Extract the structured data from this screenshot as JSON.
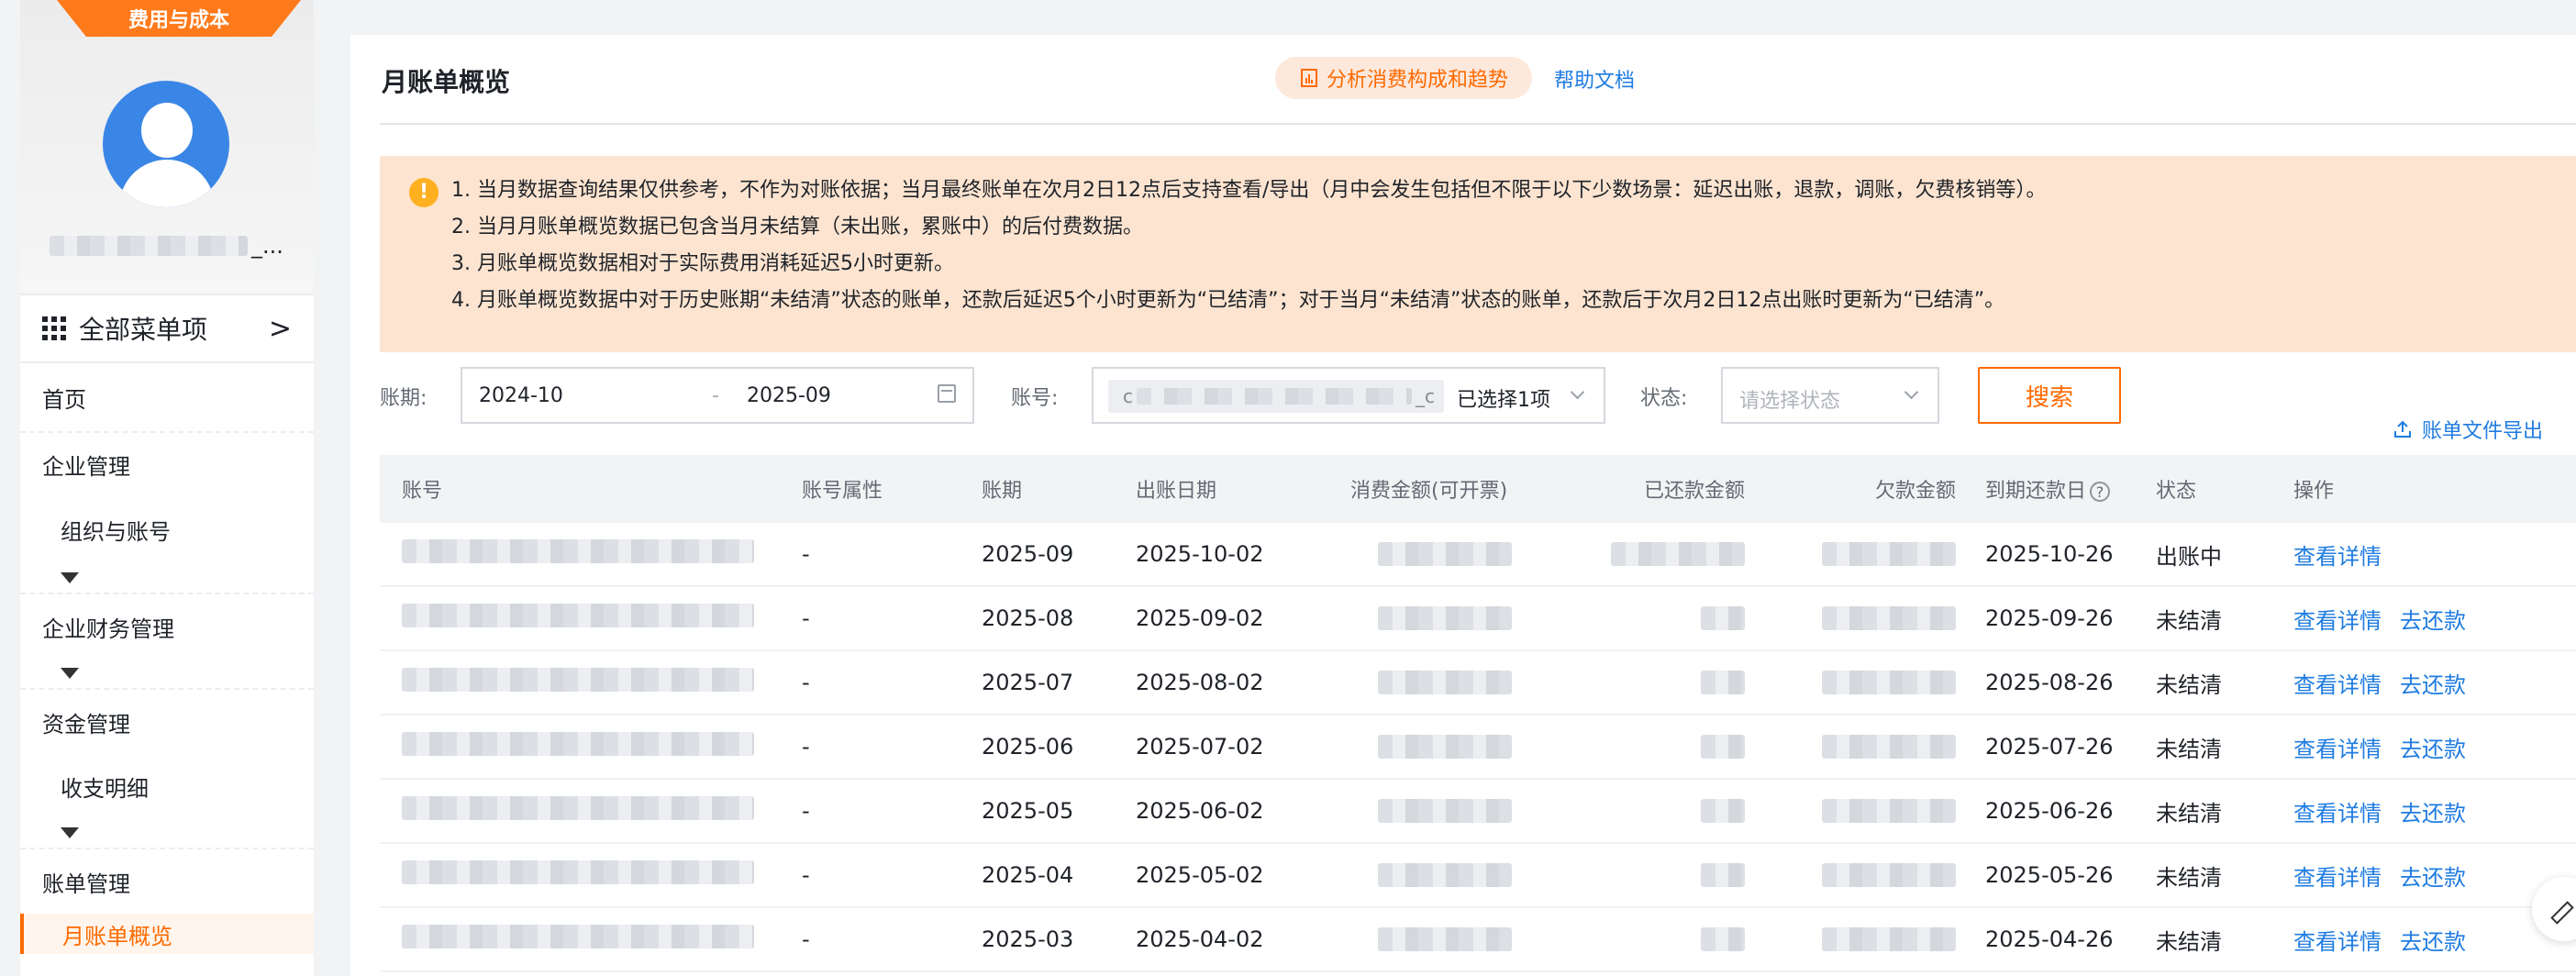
{
  "sidebar": {
    "ribbon": "费用与成本",
    "profile_suffix": "_...",
    "all_menu": "全部菜单项",
    "items": [
      {
        "label": "首页"
      },
      {
        "label": "企业管理"
      },
      {
        "label": "组织与账号"
      },
      {
        "label": "企业财务管理"
      },
      {
        "label": "资金管理"
      },
      {
        "label": "收支明细"
      },
      {
        "label": "账单管理"
      },
      {
        "label": "月账单概览"
      }
    ]
  },
  "header": {
    "title": "月账单概览",
    "analysis_button": "分析消费构成和趋势",
    "help_link": "帮助文档"
  },
  "notice": {
    "lines": [
      "1. 当月数据查询结果仅供参考，不作为对账依据；当月最终账单在次月2日12点后支持查看/导出（月中会发生包括但不限于以下少数场景：延迟出账，退款，调账，欠费核销等）。",
      "2. 当月月账单概览数据已包含当月未结算（未出账，累账中）的后付费数据。",
      "3. 月账单概览数据相对于实际费用消耗延迟5小时更新。",
      "4. 月账单概览数据中对于历史账期“未结清”状态的账单，还款后延迟5个小时更新为“已结清”；对于当月“未结清”状态的账单，还款后于次月2日12点出账时更新为“已结清”。"
    ]
  },
  "filters": {
    "period_label": "账期:",
    "period_start": "2024-10",
    "period_sep": "-",
    "period_end": "2025-09",
    "account_label": "账号:",
    "account_chip_prefix": "c",
    "account_chip_suffix": "_c",
    "account_selected": "已选择1项",
    "status_label": "状态:",
    "status_placeholder": "请选择状态",
    "search_button": "搜索"
  },
  "export_link": "账单文件导出",
  "table": {
    "headers": [
      "账号",
      "账号属性",
      "账期",
      "出账日期",
      "消费金额(可开票)",
      "已还款金额",
      "欠款金额",
      "到期还款日",
      "状态",
      "操作"
    ],
    "rows": [
      {
        "attr": "-",
        "period": "2025-09",
        "bill_date": "2025-10-02",
        "due_date": "2025-10-26",
        "status": "出账中",
        "actions": [
          "查看详情"
        ]
      },
      {
        "attr": "-",
        "period": "2025-08",
        "bill_date": "2025-09-02",
        "due_date": "2025-09-26",
        "status": "未结清",
        "actions": [
          "查看详情",
          "去还款"
        ]
      },
      {
        "attr": "-",
        "period": "2025-07",
        "bill_date": "2025-08-02",
        "due_date": "2025-08-26",
        "status": "未结清",
        "actions": [
          "查看详情",
          "去还款"
        ]
      },
      {
        "attr": "-",
        "period": "2025-06",
        "bill_date": "2025-07-02",
        "due_date": "2025-07-26",
        "status": "未结清",
        "actions": [
          "查看详情",
          "去还款"
        ]
      },
      {
        "attr": "-",
        "period": "2025-05",
        "bill_date": "2025-06-02",
        "due_date": "2025-06-26",
        "status": "未结清",
        "actions": [
          "查看详情",
          "去还款"
        ]
      },
      {
        "attr": "-",
        "period": "2025-04",
        "bill_date": "2025-05-02",
        "due_date": "2025-05-26",
        "status": "未结清",
        "actions": [
          "查看详情",
          "去还款"
        ]
      },
      {
        "attr": "-",
        "period": "2025-03",
        "bill_date": "2025-04-02",
        "due_date": "2025-04-26",
        "status": "未结清",
        "actions": [
          "查看详情",
          "去还款"
        ]
      }
    ]
  },
  "colors": {
    "accent": "#ff6a00",
    "link": "#1f7ce0",
    "notice_bg": "#fde4d0"
  }
}
